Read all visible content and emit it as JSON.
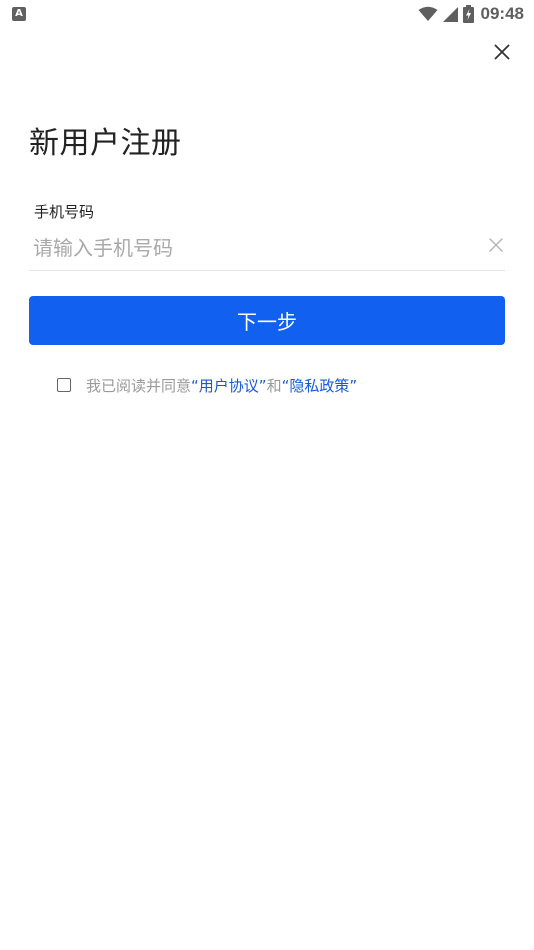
{
  "status_bar": {
    "app_icon_letter": "A",
    "time": "09:48",
    "icons": [
      "wifi-icon",
      "signal-icon",
      "battery-charging-icon"
    ]
  },
  "header": {
    "close_icon": "close-icon"
  },
  "title": "新用户注册",
  "phone_field": {
    "label": "手机号码",
    "placeholder": "请输入手机号码",
    "value": "",
    "clear_icon": "clear-icon"
  },
  "next_button": {
    "label": "下一步"
  },
  "agreement": {
    "checked": false,
    "prefix": "我已阅读并同意",
    "user_agreement": "“用户协议”",
    "and": "和",
    "privacy_policy": "“隐私政策”"
  },
  "colors": {
    "accent": "#1260f0",
    "link": "#1459d6"
  }
}
